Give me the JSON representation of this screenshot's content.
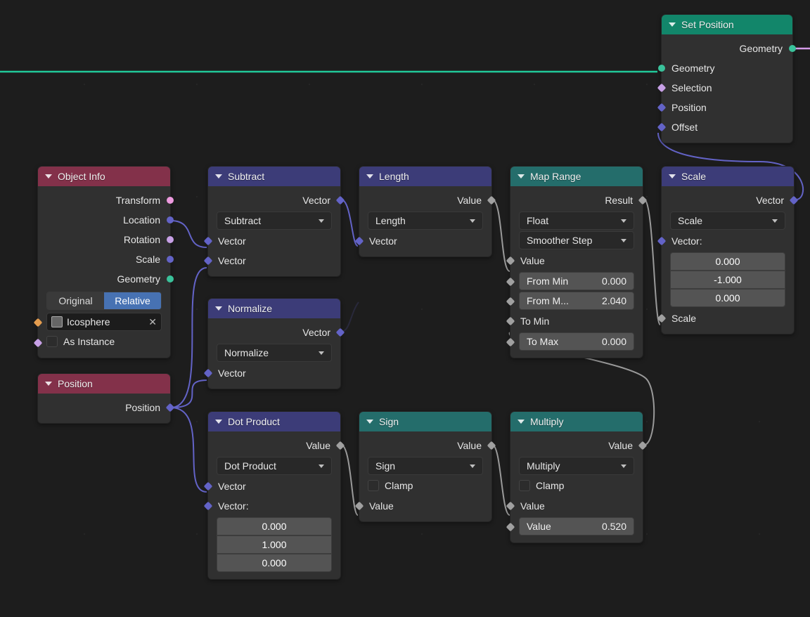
{
  "nodes": {
    "set_position": {
      "title": "Set Position",
      "out_geometry": "Geometry",
      "in_geometry": "Geometry",
      "in_selection": "Selection",
      "in_position": "Position",
      "in_offset": "Offset"
    },
    "object_info": {
      "title": "Object Info",
      "out_transform": "Transform",
      "out_location": "Location",
      "out_rotation": "Rotation",
      "out_scale": "Scale",
      "out_geometry": "Geometry",
      "toggle_a": "Original",
      "toggle_b": "Relative",
      "object_name": "Icosphere",
      "as_instance": "As Instance"
    },
    "position_node": {
      "title": "Position",
      "out_position": "Position"
    },
    "subtract": {
      "title": "Subtract",
      "out_vector": "Vector",
      "mode": "Subtract",
      "in_vector_a": "Vector",
      "in_vector_b": "Vector"
    },
    "normalize": {
      "title": "Normalize",
      "out_vector": "Vector",
      "mode": "Normalize",
      "in_vector": "Vector"
    },
    "dot_product": {
      "title": "Dot Product",
      "out_value": "Value",
      "mode": "Dot Product",
      "in_vector_label": "Vector",
      "in_vector2_label": "Vector:",
      "v_x": "0.000",
      "v_y": "1.000",
      "v_z": "0.000"
    },
    "length": {
      "title": "Length",
      "out_value": "Value",
      "mode": "Length",
      "in_vector": "Vector"
    },
    "sign": {
      "title": "Sign",
      "out_value": "Value",
      "mode": "Sign",
      "clamp": "Clamp",
      "in_value": "Value"
    },
    "map_range": {
      "title": "Map Range",
      "out_result": "Result",
      "type": "Float",
      "interp": "Smoother Step",
      "in_value": "Value",
      "from_min_label": "From Min",
      "from_min_val": "0.000",
      "from_max_label": "From M...",
      "from_max_val": "2.040",
      "to_min_label": "To Min",
      "to_max_label": "To Max",
      "to_max_val": "0.000"
    },
    "multiply": {
      "title": "Multiply",
      "out_value": "Value",
      "mode": "Multiply",
      "clamp": "Clamp",
      "in_value": "Value",
      "value2_label": "Value",
      "value2_val": "0.520"
    },
    "scale": {
      "title": "Scale",
      "out_vector": "Vector",
      "mode": "Scale",
      "in_vector_label": "Vector:",
      "v_x": "0.000",
      "v_y": "-1.000",
      "v_z": "0.000",
      "in_scale": "Scale"
    }
  }
}
